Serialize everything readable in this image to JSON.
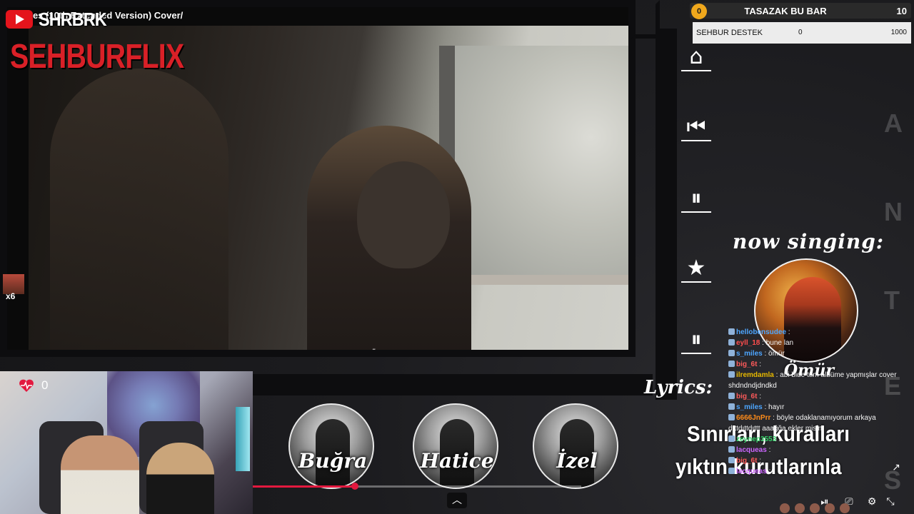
{
  "video": {
    "title": "es (10th Extended Version) Cover/",
    "caption": "tes"
  },
  "branding": {
    "channel_tag": "SHRBRK",
    "brand_name": "SEHBURFLIX",
    "emote_count": "x6"
  },
  "webcam": {
    "heart_count": "0"
  },
  "score": {
    "coin": "0",
    "title": "TASAZAK BU BAR",
    "value": "10",
    "goal_label": "SEHBUR DESTEK",
    "goal_current": "0",
    "goal_target": "1000",
    "goal_progress": 0
  },
  "controls": {
    "home_icon": "⌂",
    "prev_icon": "⏮",
    "pause_icon": "⏸",
    "star_icon": "★",
    "pause2_icon": "⏸"
  },
  "side_letters": [
    "A",
    "N",
    "T",
    "E",
    "S"
  ],
  "now_singing": {
    "label": "now singing:",
    "name": "Ömür"
  },
  "singers": [
    {
      "name": "Buğra"
    },
    {
      "name": "Hatice"
    },
    {
      "name": "İzel"
    }
  ],
  "progress": {
    "played_fraction": 0.31
  },
  "lyrics": {
    "title": "Lyrics:",
    "line1": "Sınırları, kuralları",
    "line2": "yıktın kurutlarınla"
  },
  "chat": [
    {
      "user": "hellobensudee",
      "msg": ":",
      "color": "#4da6ff"
    },
    {
      "user": "eyll_18",
      "msg": ": bune lan",
      "color": "#ff4d4d"
    },
    {
      "user": "s_miles",
      "msg": ": ömür",
      "color": "#4da6ff"
    },
    {
      "user": "big_6t",
      "msg": ":",
      "color": "#ff5a5a"
    },
    {
      "user": "ilremdamla",
      "msg": ": abi bide tüm albüme yapmışlar cover",
      "color": "#e6b800"
    },
    {
      "user": "",
      "msg": "shdndndjdndkd",
      "color": "#ffffff"
    },
    {
      "user": "big_6t",
      "msg": ":",
      "color": "#ff5a5a"
    },
    {
      "user": "s_miles",
      "msg": ": hayır",
      "color": "#4da6ff"
    },
    {
      "user": "6666JnPrr",
      "msg": ": böyle odaklanamıyorum arkaya",
      "color": "#ff8c1a"
    },
    {
      "user": "",
      "msg": "dıttdıttdıttt aaağğa ekler misin",
      "color": "#ffffff"
    },
    {
      "user": "zeynep3553",
      "msg": ":",
      "color": "#33cc66"
    },
    {
      "user": "lacqueas",
      "msg": ":",
      "color": "#cc66ff"
    },
    {
      "user": "big_6t",
      "msg": ":",
      "color": "#ff5a5a"
    },
    {
      "user": "lacqueas",
      "msg": ":",
      "color": "#cc66ff"
    }
  ],
  "player_icons": [
    "⏯",
    "⎚",
    "⚙",
    "⤡",
    "↗"
  ]
}
